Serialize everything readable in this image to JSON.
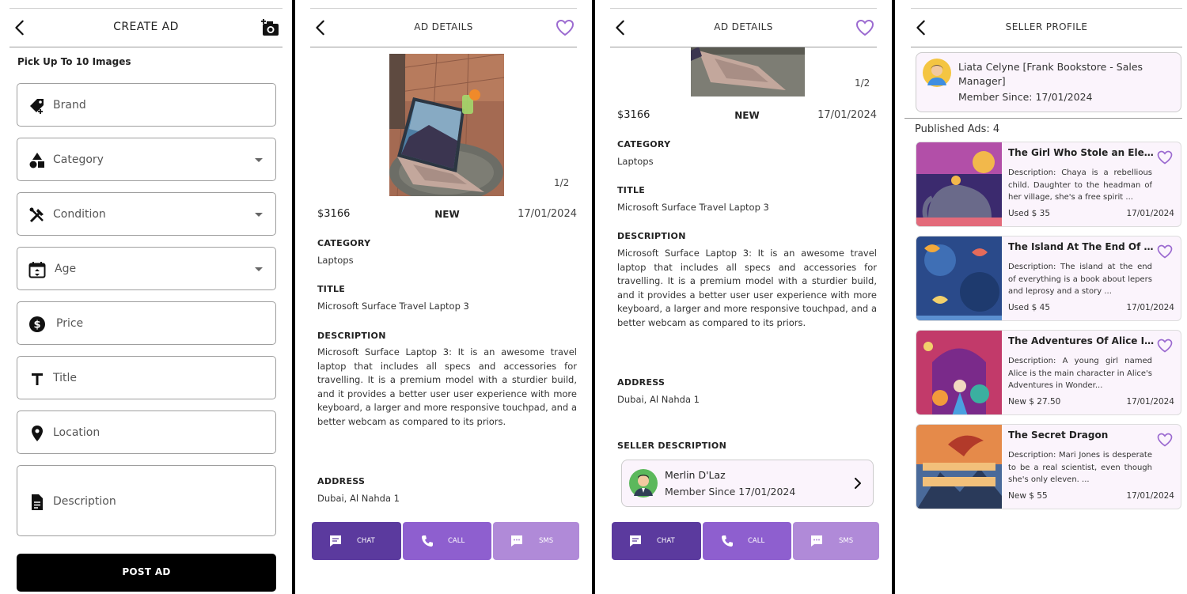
{
  "colors": {
    "accent": "#9b6ad0",
    "chat_button": "#5b3a9e",
    "call_button": "#8e5fcf",
    "sms_button": "#b08ad8",
    "card_bg": "#fbf4fc"
  },
  "create_ad": {
    "title": "CREATE AD",
    "pick_label": "Pick Up To 10 Images",
    "fields": [
      {
        "label": "Brand",
        "icon": "tag-icon"
      },
      {
        "label": "Category",
        "icon": "shapes-icon"
      },
      {
        "label": "Condition",
        "icon": "tools-icon"
      },
      {
        "label": "Age",
        "icon": "calendar-icon"
      },
      {
        "label": "Price",
        "icon": "dollar-coin-icon"
      },
      {
        "label": "Title",
        "icon": "text-t-icon"
      },
      {
        "label": "Location",
        "icon": "location-pin-icon"
      },
      {
        "label": "Description",
        "icon": "document-icon"
      }
    ],
    "post_label": "POST AD"
  },
  "ad_details": {
    "title": "AD DETAILS",
    "counter": "1/2",
    "price": "$3166",
    "condition": "NEW",
    "date": "17/01/2024",
    "category_h": "CATEGORY",
    "category": "Laptops",
    "title_h": "TITLE",
    "title_v": "Microsoft Surface Travel Laptop 3",
    "description_h": "DESCRIPTION",
    "description": "Microsoft Surface Laptop 3: It is an awesome travel laptop that includes all specs and accessories for travelling. It is a premium model with a sturdier build, and it provides a better user user experience with more keyboard, a larger and more responsive touchpad, and a better webcam as compared to its priors.",
    "address_h": "ADDRESS",
    "address": "Dubai, Al Nahda 1",
    "seller_h": "SELLER DESCRIPTION",
    "seller_name": "Merlin D'Laz",
    "seller_since": "Member Since 17/01/2024",
    "chat": "CHAT",
    "call": "CALL",
    "sms": "SMS"
  },
  "seller_profile": {
    "title": "SELLER PROFILE",
    "name": "Liata Celyne [Frank Bookstore - Sales Manager]",
    "since": "Member Since: 17/01/2024",
    "published": "Published Ads:  4",
    "ads": [
      {
        "title": "The Girl Who Stole an Eleph...",
        "desc": "Description: Chaya is a rebellious child. Daughter to the headman of her village, she's a free spirit ...",
        "price": "Used $ 35",
        "date": "17/01/2024"
      },
      {
        "title": "The Island At The End Of Ev...",
        "desc": "Description: The island at the end of everything is a book about lepers and leprosy and a story ...",
        "price": "Used $ 45",
        "date": "17/01/2024"
      },
      {
        "title": "The Adventures Of Alice In ...",
        "desc": "Description: A young girl named Alice is the main character in Alice's Adventures in Wonder...",
        "price": "New $ 27.50",
        "date": "17/01/2024"
      },
      {
        "title": "The Secret Dragon",
        "desc": "Description: Mari Jones is desperate to be a real scientist, even though she's only eleven. ...",
        "price": "New $ 55",
        "date": "17/01/2024"
      }
    ]
  }
}
